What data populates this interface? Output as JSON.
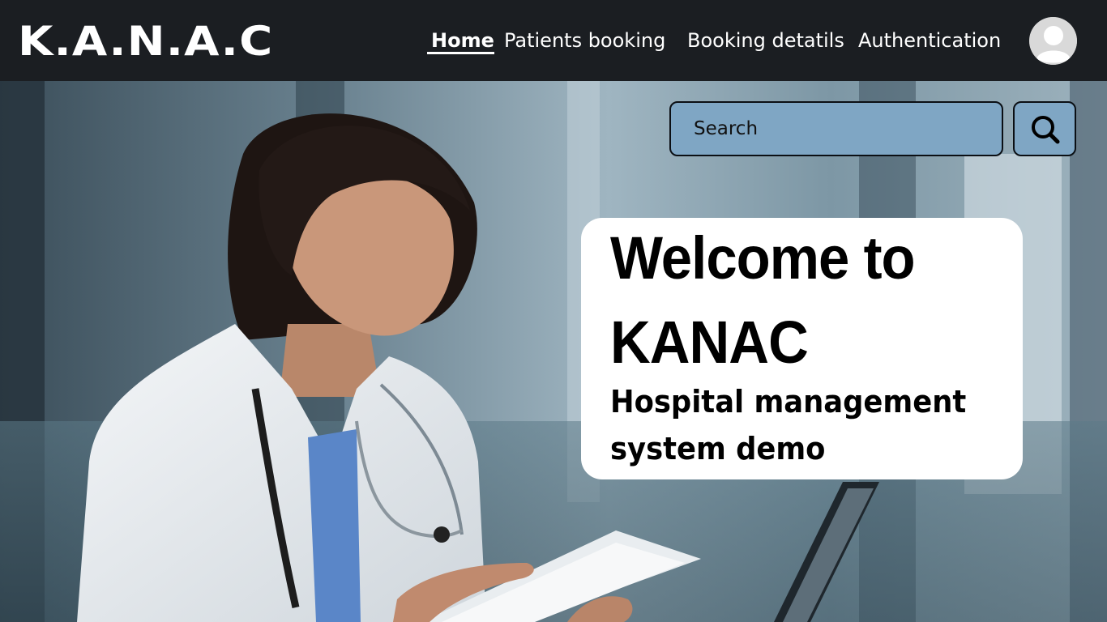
{
  "header": {
    "logo": "K.A.N.A.C",
    "nav": {
      "home": "Home",
      "patients_booking": "Patients booking",
      "booking_details": "Booking detatils",
      "authentication": "Authentication"
    },
    "avatar_icon": "user-avatar-icon"
  },
  "search": {
    "placeholder": "Search",
    "button_icon": "search-icon"
  },
  "hero": {
    "image": "doctor-with-tablet-photo",
    "welcome_line1": "Welcome to",
    "welcome_line2": "KANAC",
    "subtitle_line1": "Hospital  management",
    "subtitle_line2": "system demo"
  },
  "colors": {
    "topbar": "#1b1e22",
    "search_fill": "#7fa6c4",
    "card": "#ffffff",
    "text_light": "#ffffff",
    "text_dark": "#000000"
  }
}
